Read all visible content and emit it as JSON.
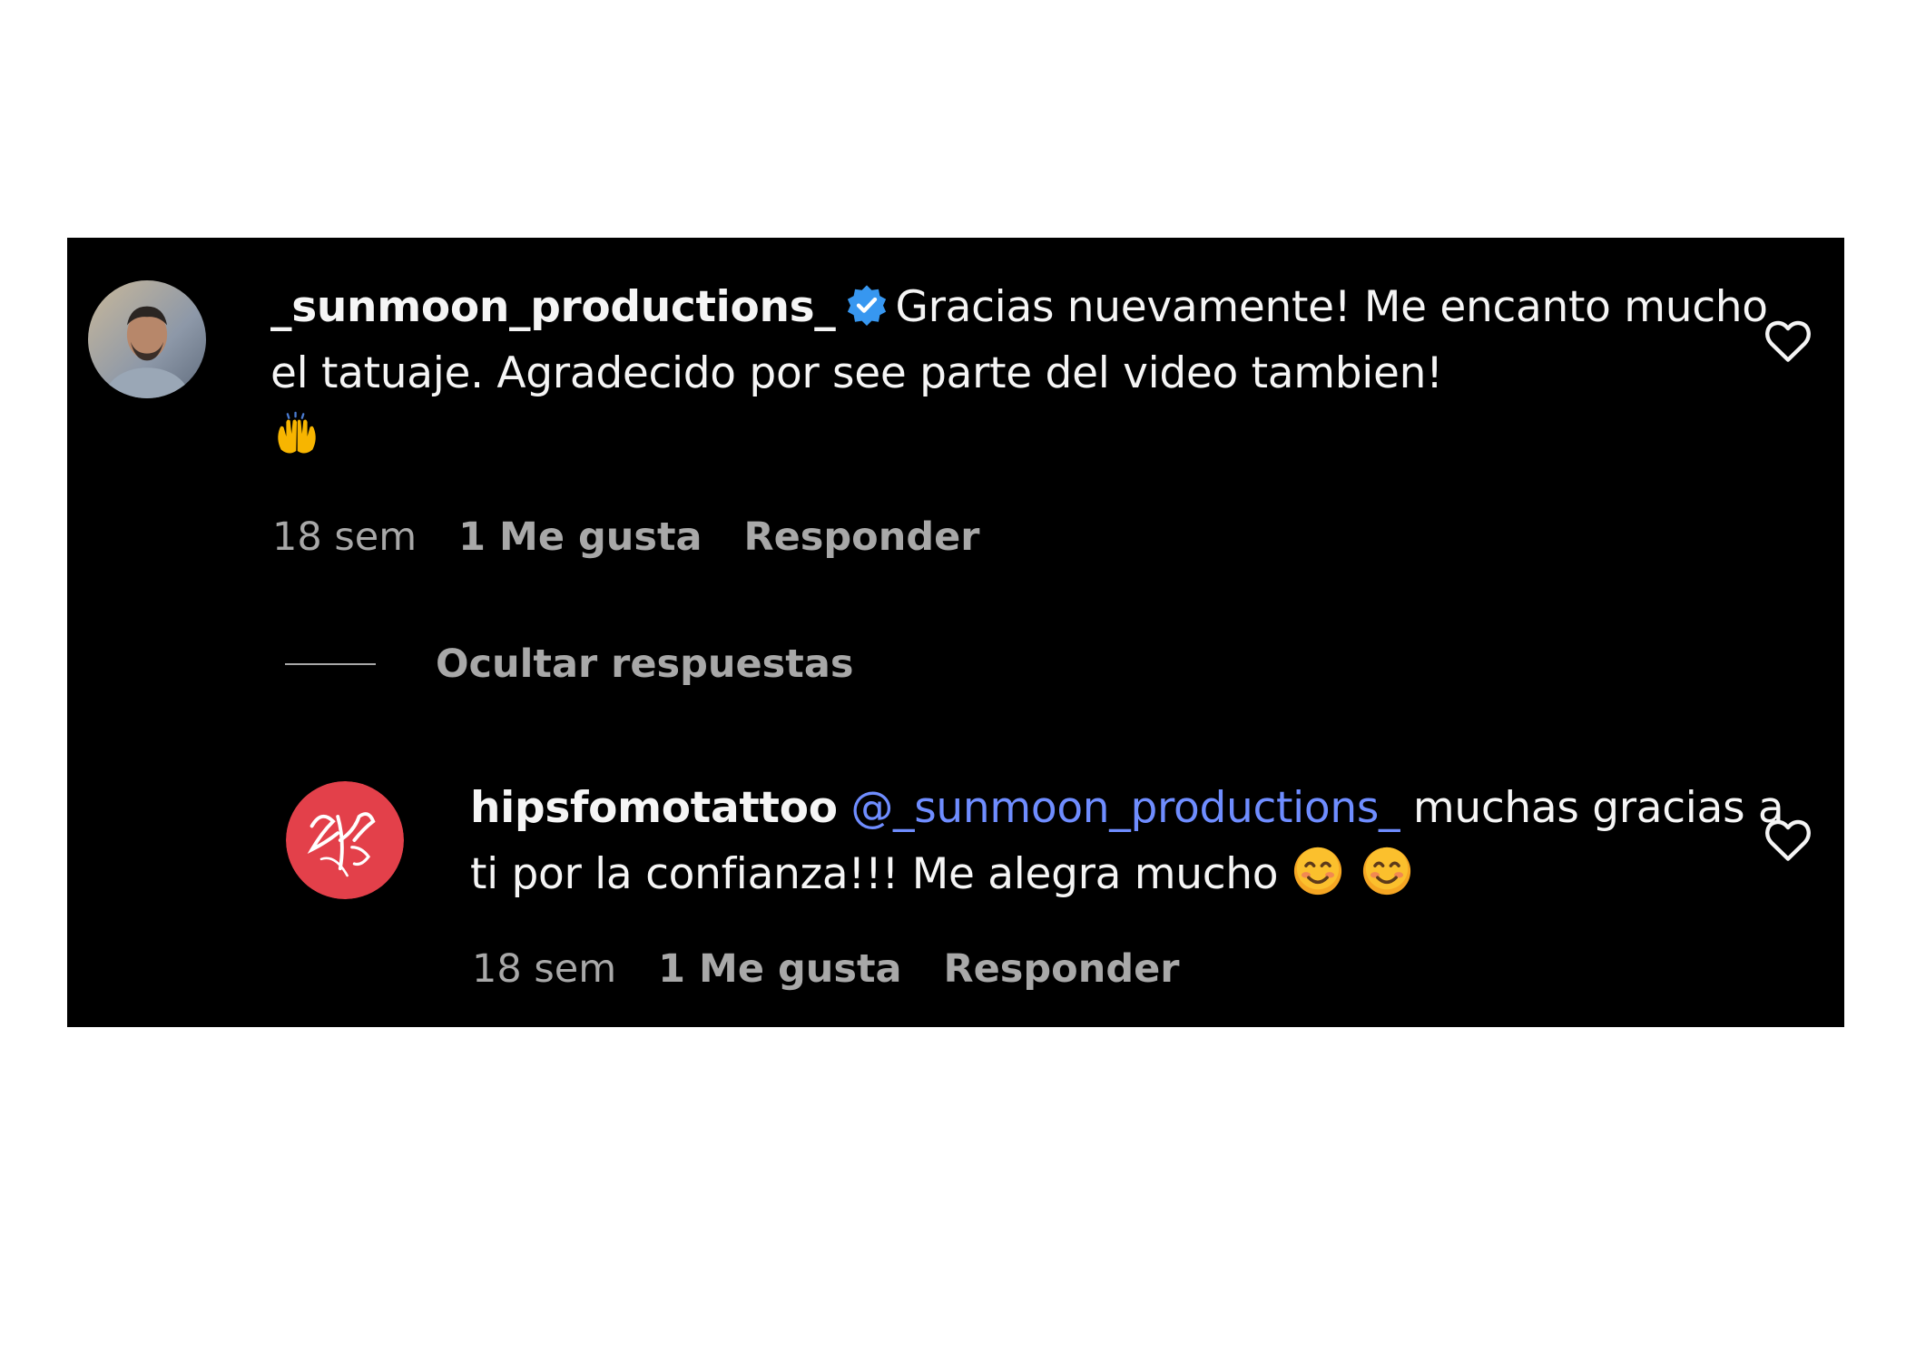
{
  "comments": {
    "main": {
      "username": "_sunmoon_productions_",
      "verified_icon": "verified-badge-icon",
      "text": "Gracias nuevamente! Me encanto mucho el tatuaje. Agradecido por see parte del video tambien!",
      "emoji_icon": "raising-hands-icon",
      "time": "18 sem",
      "likes": "1 Me gusta",
      "reply_label": "Responder"
    },
    "hide_replies_label": "Ocultar respuestas",
    "reply": {
      "username": "hipsfomotattoo",
      "mention": "@_sunmoon_productions_",
      "text": "muchas gracias a ti por la confianza!!! Me alegra mucho",
      "emoji_icon": "smiling-face-icon",
      "time": "18 sem",
      "likes": "1 Me gusta",
      "reply_label": "Responder"
    }
  },
  "colors": {
    "background": "#000000",
    "primary_text": "#f5f5f5",
    "secondary_text": "#a8a8a8",
    "mention": "#6f8dff",
    "verified": "#3797f0",
    "reply_avatar": "#e3404a"
  }
}
